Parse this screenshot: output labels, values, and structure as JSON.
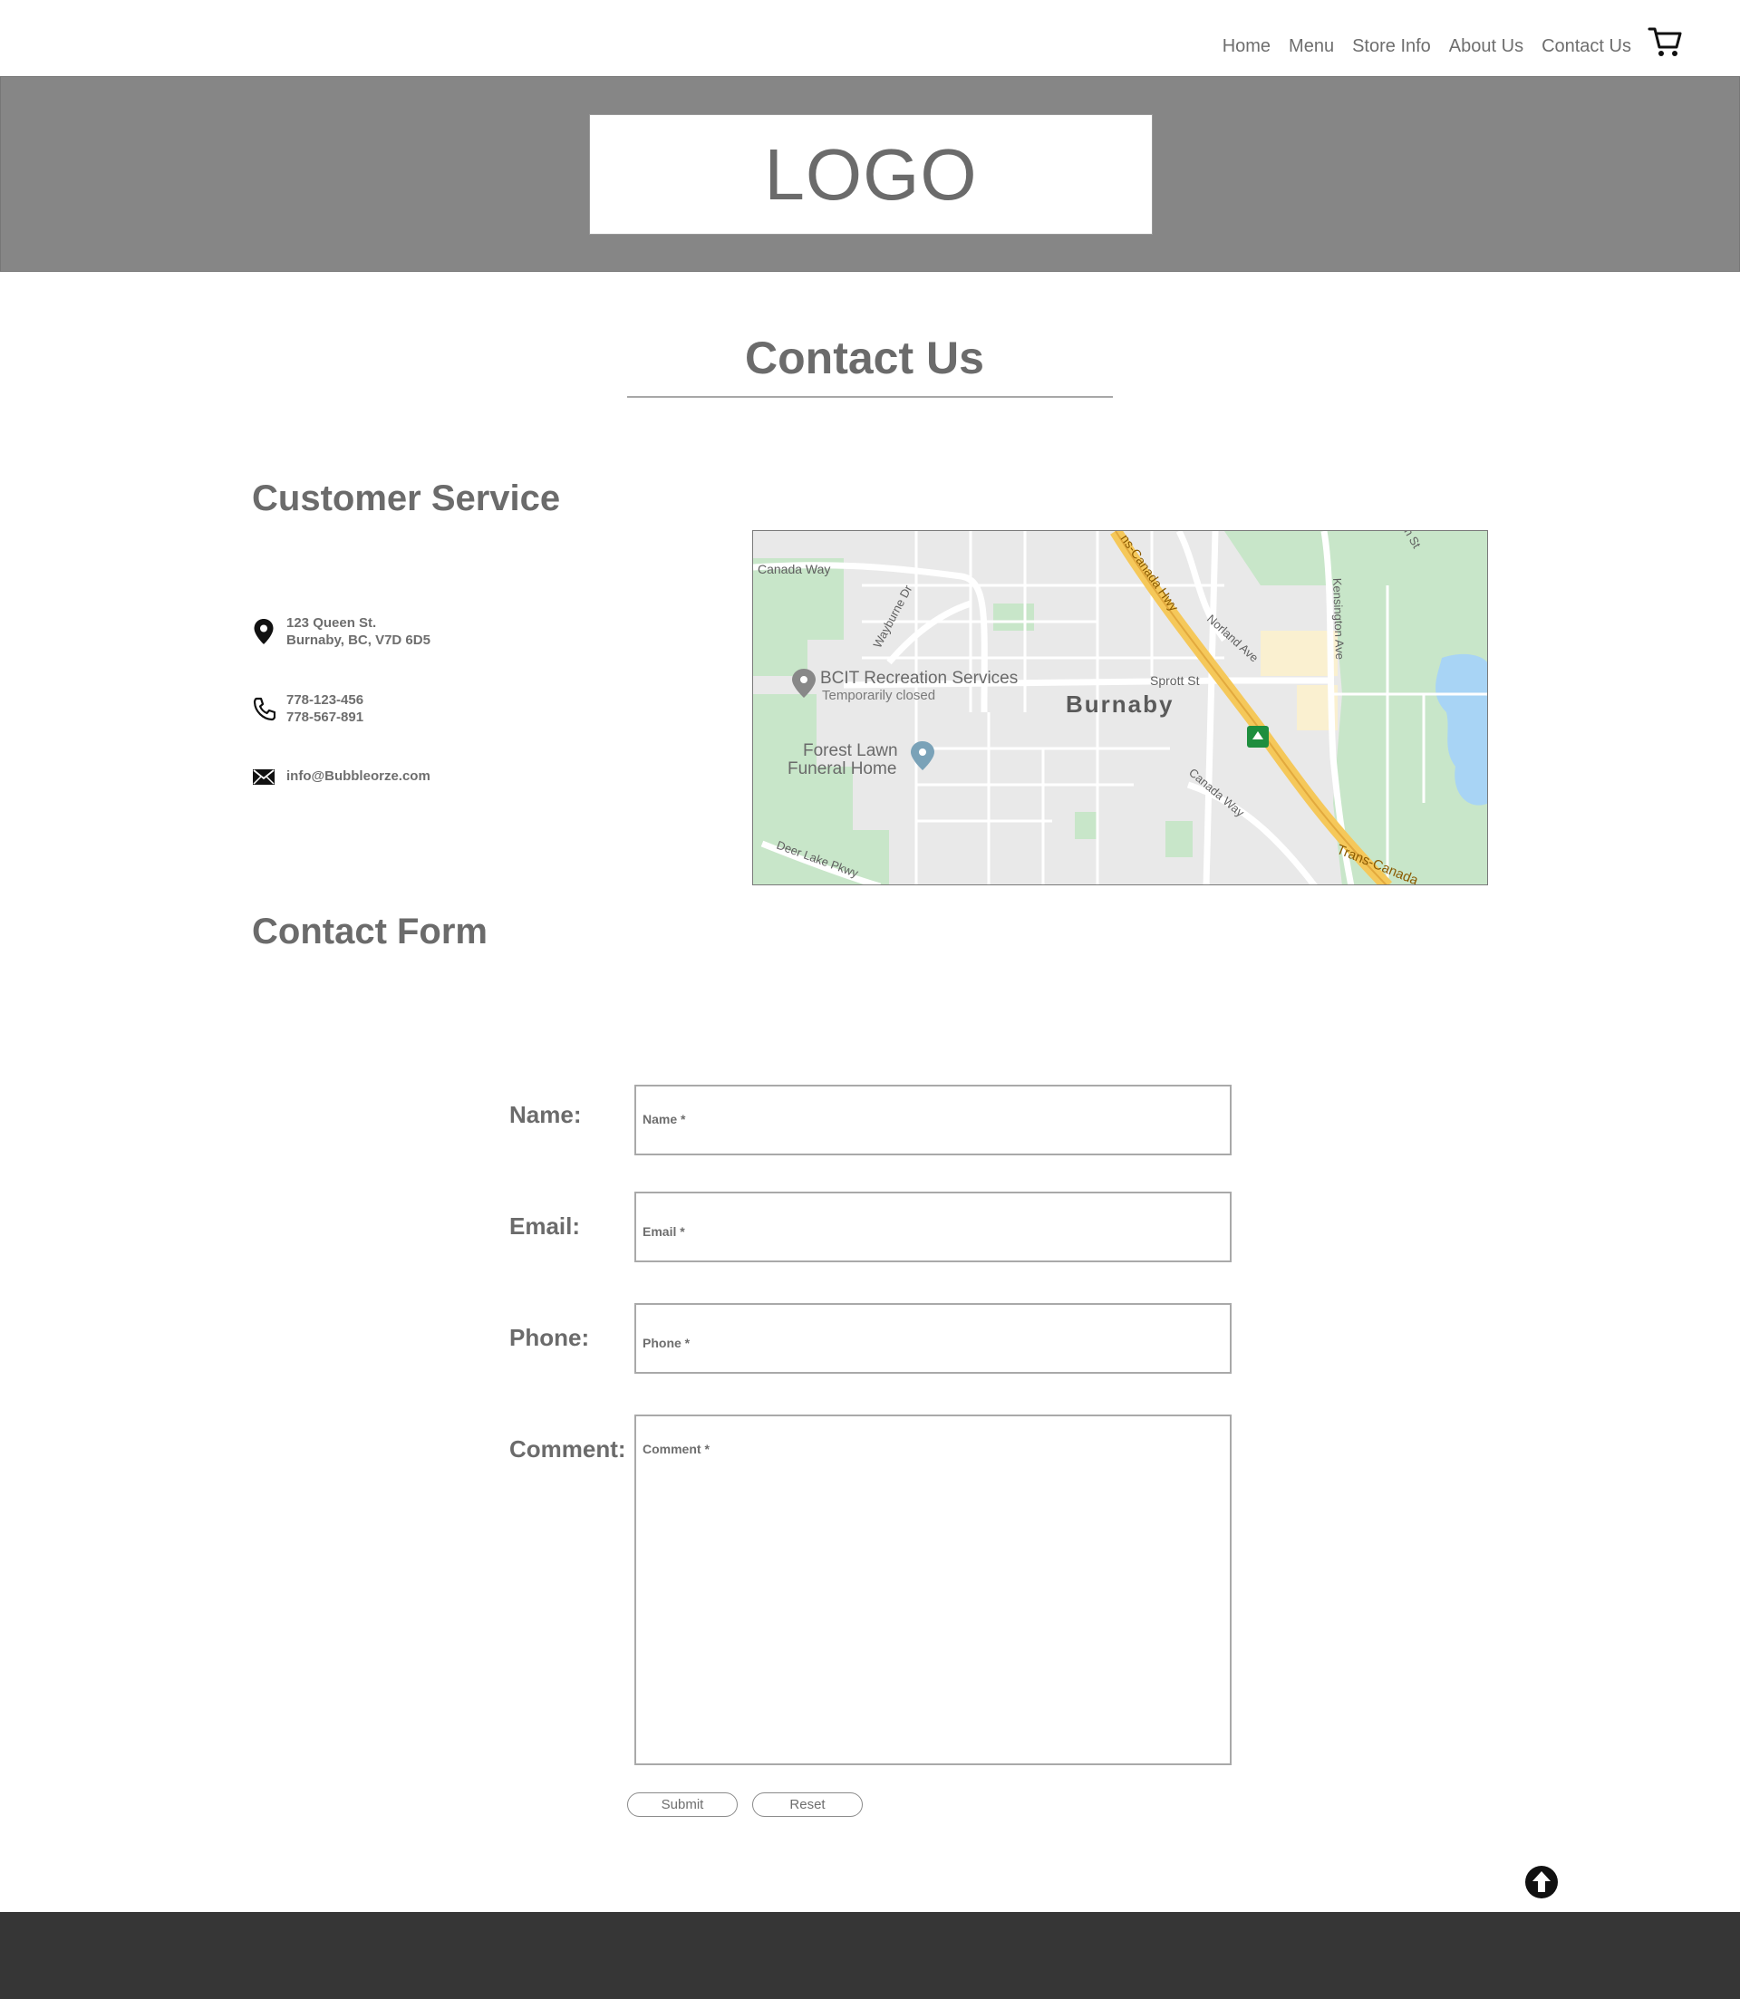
{
  "nav": {
    "items": [
      "Home",
      "Menu",
      "Store Info",
      "About Us",
      "Contact Us"
    ],
    "cart_icon": "shopping-cart-icon"
  },
  "header": {
    "logo": "LOGO"
  },
  "page": {
    "title": "Contact Us"
  },
  "customer_service": {
    "heading": "Customer Service",
    "address": {
      "line1": "123 Queen St.",
      "line2": "Burnaby, BC, V7D 6D5",
      "icon": "map-pin-icon"
    },
    "phone": {
      "line1": "778-123-456",
      "line2": "778-567-891",
      "icon": "phone-icon"
    },
    "email": {
      "value": "info@Bubbleorze.com",
      "icon": "envelope-icon"
    }
  },
  "map": {
    "labels": {
      "canada_way_top": "Canada Way",
      "wayburne": "Wayburne Dr",
      "trans_canada_top": "ns-Canada Hwy",
      "norland": "Norland Ave",
      "kensington": "Kensington Ave",
      "sprott": "Sprott St",
      "city": "Burnaby",
      "poi1_name": "BCIT Recreation Services",
      "poi1_status": "Temporarily closed",
      "poi2_line1": "Forest Lawn",
      "poi2_line2": "Funeral Home",
      "canada_way_bottom": "Canada Way",
      "deer_lake": "Deer Lake Pkwy",
      "trans_canada_bottom": "Trans-Canada",
      "corner_st": "n St"
    }
  },
  "contact_form": {
    "heading": "Contact Form",
    "fields": {
      "name": {
        "label": "Name:",
        "placeholder": "Name *"
      },
      "email": {
        "label": "Email:",
        "placeholder": "Email *"
      },
      "phone": {
        "label": "Phone:",
        "placeholder": "Phone *"
      },
      "comment": {
        "label": "Comment:",
        "placeholder": "Comment *"
      }
    },
    "submit_label": "Submit",
    "reset_label": "Reset"
  },
  "back_to_top_icon": "arrow-up-circle-icon",
  "colors": {
    "banner": "#868686",
    "footer": "#363636",
    "text": "#6b6b6b",
    "map_road_major": "#f5c85a",
    "map_park": "#c8e6c9",
    "map_water": "#a8d4f5"
  }
}
